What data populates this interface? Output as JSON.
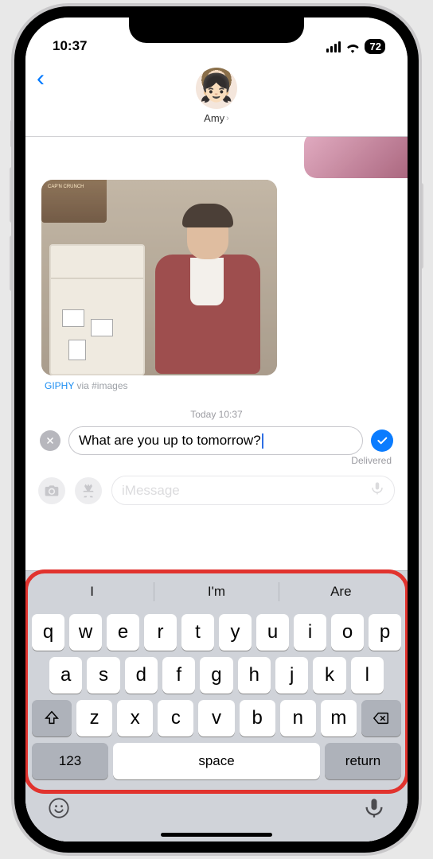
{
  "statusbar": {
    "time": "10:37",
    "battery": "72"
  },
  "header": {
    "contact_name": "Amy",
    "avatar_emoji": "👧🏻"
  },
  "conversation": {
    "gif_attribution_source": "GIPHY",
    "gif_attribution_via": " via #images",
    "timestamp": "Today 10:37",
    "delivered_label": "Delivered",
    "cab_label": "CAP'N CRUNCH"
  },
  "editing": {
    "text": "What are you up to tomorrow?"
  },
  "compose": {
    "placeholder": "iMessage"
  },
  "keyboard": {
    "suggestions": [
      "I",
      "I'm",
      "Are"
    ],
    "row1": [
      "q",
      "w",
      "e",
      "r",
      "t",
      "y",
      "u",
      "i",
      "o",
      "p"
    ],
    "row2": [
      "a",
      "s",
      "d",
      "f",
      "g",
      "h",
      "j",
      "k",
      "l"
    ],
    "row3": [
      "z",
      "x",
      "c",
      "v",
      "b",
      "n",
      "m"
    ],
    "numbers_key": "123",
    "space_key": "space",
    "return_key": "return"
  }
}
